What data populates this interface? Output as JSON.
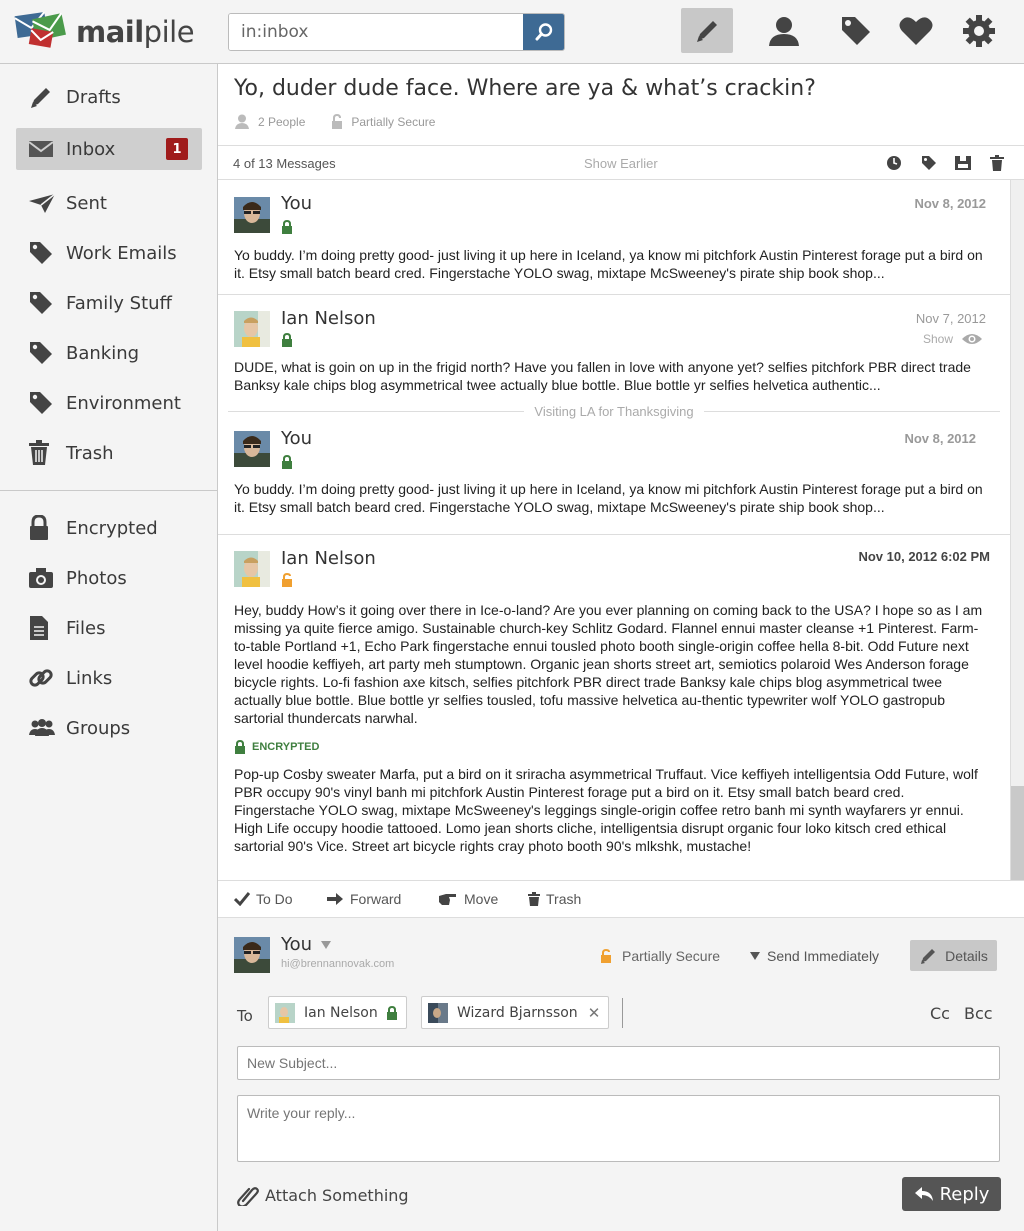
{
  "app": {
    "name_bold": "mail",
    "name_rest": "pile"
  },
  "search": {
    "value": "in:inbox"
  },
  "topnav": {
    "icons": [
      "compose-icon",
      "contacts-icon",
      "tags-icon",
      "favorites-icon",
      "settings-icon"
    ]
  },
  "sidebar": {
    "items": [
      {
        "label": "Drafts",
        "icon": "pencil-icon"
      },
      {
        "label": "Inbox",
        "icon": "envelope-icon",
        "badge": "1"
      },
      {
        "label": "Sent",
        "icon": "paper-plane-icon"
      },
      {
        "label": "Work Emails",
        "icon": "tag-icon"
      },
      {
        "label": "Family Stuff",
        "icon": "tag-icon"
      },
      {
        "label": "Banking",
        "icon": "tag-icon"
      },
      {
        "label": "Environment",
        "icon": "tag-icon"
      },
      {
        "label": "Trash",
        "icon": "trash-icon"
      },
      {
        "label": "Encrypted",
        "icon": "lock-icon"
      },
      {
        "label": "Photos",
        "icon": "camera-icon"
      },
      {
        "label": "Files",
        "icon": "file-icon"
      },
      {
        "label": "Links",
        "icon": "link-icon"
      },
      {
        "label": "Groups",
        "icon": "group-icon"
      }
    ]
  },
  "thread": {
    "title": "Yo, duder dude face. Where are ya & what’s crackin?",
    "people": "2 People",
    "security": "Partially Secure",
    "count": "4 of 13 Messages",
    "show_earlier": "Show Earlier"
  },
  "messages": [
    {
      "from": "You",
      "date": "Nov 8, 2012",
      "body": "Yo buddy. I’m doing pretty good- just living it up here in Iceland, ya know mi pitchfork Austin Pinterest forage put a bird on it. Etsy small batch beard cred. Fingerstache YOLO swag, mixtape McSweeney's pirate ship book shop..."
    },
    {
      "from": "Ian Nelson",
      "date": "Nov 7, 2012",
      "show": "Show",
      "body": "DUDE, what is goin on up in the frigid north? Have you fallen in love with anyone yet? selfies pitchfork PBR direct trade Banksy kale chips blog asymmetrical twee actually blue bottle. Blue bottle yr selfies helvetica authentic..."
    },
    {
      "divider": "Visiting LA for Thanksgiving",
      "from": "You",
      "date": "Nov 8, 2012",
      "body": "Yo buddy. I’m doing pretty good- just living it up here in Iceland, ya know mi pitchfork Austin Pinterest forage put a bird on it. Etsy small batch beard cred. Fingerstache YOLO swag, mixtape McSweeney's pirate ship book shop..."
    },
    {
      "from": "Ian Nelson",
      "date": "Nov 10, 2012 6:02 PM",
      "body": "Hey, buddy  How’s it going over there in Ice-o-land? Are you ever planning on coming back to the USA? I hope so as I am missing ya quite fierce amigo. Sustainable church-key Schlitz Godard. Flannel ennui master cleanse +1 Pinterest. Farm-to-table Portland +1, Echo Park fingerstache ennui tousled photo booth single-origin coffee hella 8-bit. Odd Future next level hoodie keffiyeh, art party meh stumptown. Organic jean shorts street art, semiotics polaroid Wes Anderson forage bicycle rights. Lo-fi fashion axe kitsch, selfies pitchfork PBR direct trade Banksy kale chips blog asymmetrical twee actually blue bottle. Blue bottle yr selfies tousled, tofu massive helvetica au-thentic typewriter wolf YOLO gastropub sartorial thundercats narwhal.",
      "encrypted_label": "ENCRYPTED",
      "encrypted_body": "Pop-up Cosby sweater Marfa, put a bird on it sriracha asymmetrical Truffaut. Vice keffiyeh intelligentsia Odd Future, wolf PBR occupy 90's vinyl banh mi pitchfork Austin Pinterest forage put a bird on it. Etsy small batch beard cred. Fingerstache YOLO swag, mixtape McSweeney's leggings single-origin coffee retro banh mi synth wayfarers yr ennui. High Life occupy hoodie tattooed. Lomo jean shorts cliche, intelligentsia disrupt organic four loko kitsch cred ethical sartorial 90's Vice. Street art bicycle rights cray photo booth 90's mlkshk, mustache!"
    }
  ],
  "actions": {
    "todo": "To Do",
    "forward": "Forward",
    "move": "Move",
    "trash": "Trash"
  },
  "composer": {
    "from": "You",
    "email": "hi@brennannovak.com",
    "security": "Partially Secure",
    "send_mode": "Send Immediately",
    "details": "Details",
    "to_label": "To",
    "recipients": [
      "Ian Nelson",
      "Wizard Bjarnsson"
    ],
    "cc": "Cc",
    "bcc": "Bcc",
    "subject_placeholder": "New Subject...",
    "reply_placeholder": "Write your reply...",
    "attach": "Attach Something",
    "reply": "Reply"
  },
  "colors": {
    "accent_blue": "#3e6a94",
    "badge_red": "#a01c1c",
    "secure_green": "#3f7f3f",
    "warning_orange": "#f0a030"
  }
}
